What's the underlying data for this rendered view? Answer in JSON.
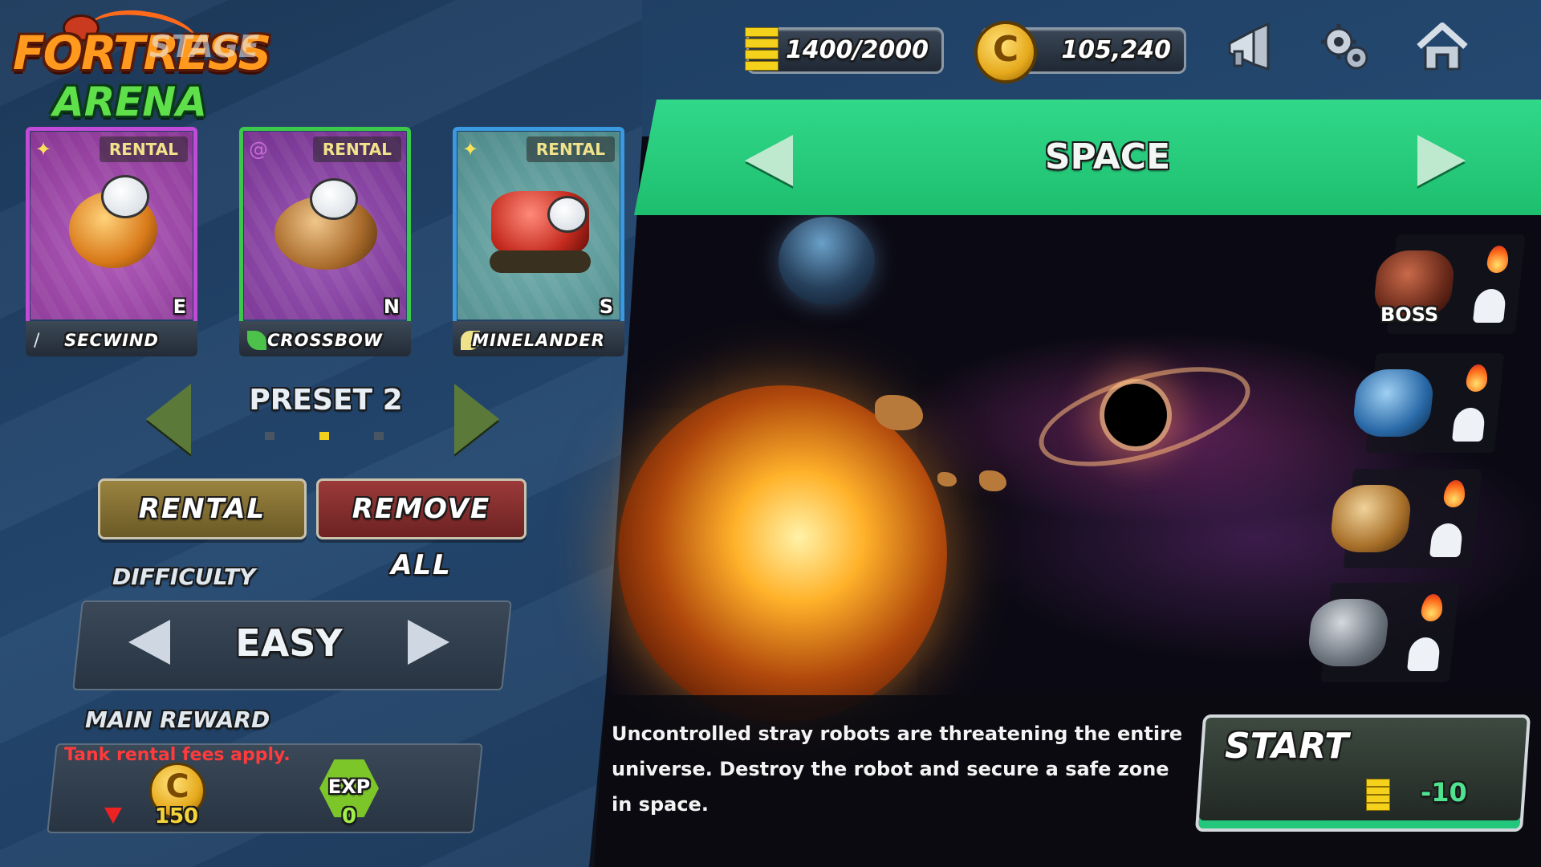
{
  "header": {
    "logo_line1": "FORTRESS",
    "logo_line2": "ARENA",
    "stage_label": "STAGE",
    "energy": "1400/2000",
    "coins": "105,240",
    "icons": [
      "megaphone-icon",
      "gear-icon",
      "home-icon"
    ]
  },
  "tanks": [
    {
      "tag": "RENTAL",
      "name": "SECWIND",
      "grade": "E",
      "color": "#c24ad8"
    },
    {
      "tag": "RENTAL",
      "name": "CROSSBOW",
      "grade": "N",
      "color": "#3cc84a"
    },
    {
      "tag": "RENTAL",
      "name": "MINELANDER",
      "grade": "S",
      "color": "#3a9ae0"
    }
  ],
  "preset": {
    "label": "PRESET 2",
    "page_count": 3,
    "active_page": 2
  },
  "buttons": {
    "rental": "RENTAL",
    "remove_all": "REMOVE ALL"
  },
  "difficulty": {
    "label": "DIFFICULTY",
    "value": "EASY"
  },
  "reward": {
    "label": "MAIN REWARD",
    "warning": "Tank rental fees apply.",
    "coin_symbol": "C",
    "coin_amount": "150",
    "exp_label": "EXP",
    "exp_amount": "0"
  },
  "stage": {
    "name": "SPACE",
    "boss_label": "BOSS",
    "description": "Uncontrolled stray robots are threatening the entire universe. Destroy the robot and secure a safe zone in space.",
    "start_label": "START",
    "start_cost": "-10"
  },
  "colors": {
    "banner": "#1dbf6e",
    "energy": "#f4d21b",
    "coin": "#e6a91c",
    "warning": "#ff3b3b"
  }
}
